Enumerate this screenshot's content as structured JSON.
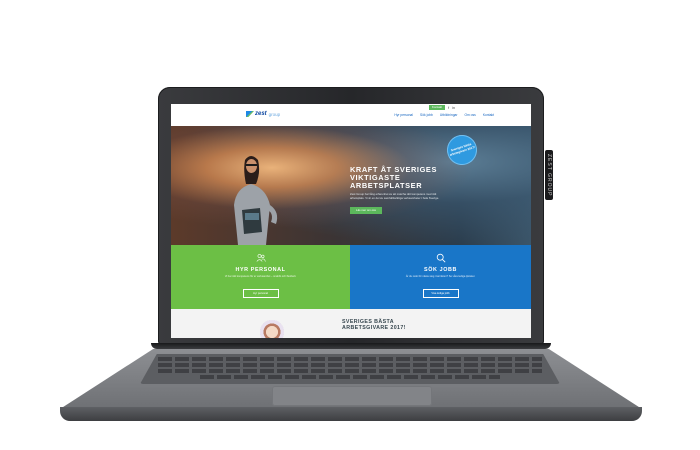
{
  "device": {
    "side_label": "ZEST GROUP"
  },
  "header": {
    "logo_brand": "zest",
    "logo_tag": "group",
    "topbar_button": "Kontakt",
    "social_1": "f",
    "social_2": "in",
    "nav": [
      "Hyr personal",
      "Sök jobb",
      "Utbildningar",
      "Om oss",
      "Kontakt"
    ]
  },
  "hero": {
    "title": "KRAFT ÅT SVERIGES VIKTIGASTE ARBETSPLATSER",
    "body": "Zest Group har lång erfarenhet av att matcha rätt kompetens med rätt arbetsplats. Vi är en del av samhällsviktiga verksamheter i hela Sverige.",
    "button": "Läs mer om oss",
    "badge": "Sveriges bästa arbetsgivare 2017!"
  },
  "panels": {
    "left": {
      "title": "HYR PERSONAL",
      "text": "Vi har rätt kompetens för er verksamhet – snabbt och flexibelt.",
      "button": "Hyr personal"
    },
    "right": {
      "title": "SÖK JOBB",
      "text": "Är du redo för nästa steg i karriären? Se våra lediga tjänster.",
      "button": "Visa lediga jobb"
    }
  },
  "bottom": {
    "title": "SVERIGES BÄSTA ARBETSGIVARE 2017!"
  },
  "colors": {
    "accent_green": "#6cbf45",
    "accent_blue": "#1976c8",
    "button_green": "#5cb85c",
    "brand_blue": "#0d47a1"
  },
  "icons": {
    "panel_left": "people-icon",
    "panel_right": "search-icon"
  }
}
